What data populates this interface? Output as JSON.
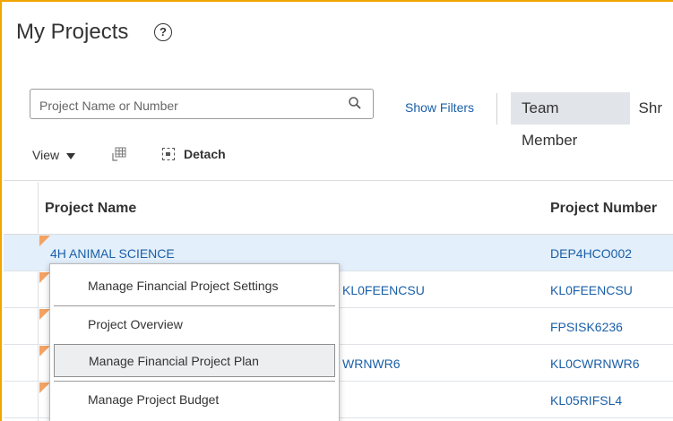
{
  "header": {
    "title": "My Projects",
    "help_icon": "?"
  },
  "search": {
    "placeholder": "Project Name or Number",
    "value": ""
  },
  "filters": {
    "show_filters_label": "Show Filters"
  },
  "segments": [
    {
      "label": "Team Member"
    },
    {
      "label": "Shr"
    }
  ],
  "toolbar": {
    "view_label": "View",
    "detach_label": "Detach"
  },
  "table": {
    "columns": [
      "Project Name",
      "Project Number"
    ],
    "rows": [
      {
        "name": "4H ANIMAL SCIENCE",
        "number": "DEP4HCO002"
      },
      {
        "name": "KL0FEENCSU",
        "number": "KL0FEENCSU"
      },
      {
        "name": "",
        "number": "FPSISK6236"
      },
      {
        "name": "WRNWR6",
        "number": "KL0CWRNWR6"
      },
      {
        "name": "",
        "number": "KL05RIFSL4"
      }
    ]
  },
  "context_menu": {
    "items": [
      {
        "label": "Manage Financial Project Settings"
      },
      {
        "label": "Project Overview"
      },
      {
        "label": "Manage Financial Project Plan"
      },
      {
        "label": "Manage Project Budget"
      }
    ]
  },
  "colors": {
    "accent": "#f0a500",
    "link": "#1a5fa8",
    "selected_row": "#e3effa",
    "flag": "#f4a261"
  }
}
